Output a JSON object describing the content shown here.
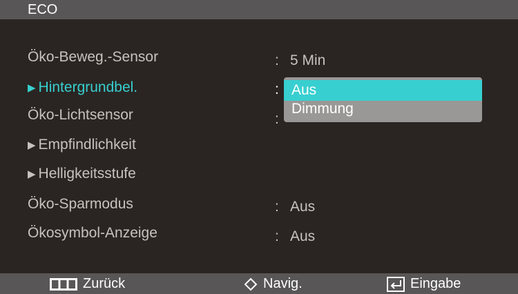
{
  "header": {
    "title": "ECO"
  },
  "menu": {
    "items": [
      {
        "label": "Öko-Beweg.-Sensor",
        "value": "5 Min"
      },
      {
        "label": "Hintergrundbel.",
        "value": ""
      },
      {
        "label": "Öko-Lichtsensor",
        "value": ""
      },
      {
        "label": "Empfindlichkeit"
      },
      {
        "label": "Helligkeitsstufe"
      },
      {
        "label": "Öko-Sparmodus",
        "value": "Aus"
      },
      {
        "label": "Ökosymbol-Anzeige",
        "value": "Aus"
      }
    ],
    "separator": ":"
  },
  "dropdown": {
    "options": [
      "Aus",
      "Dimmung"
    ],
    "selected": "Aus"
  },
  "footer": {
    "back_label": "Zurück",
    "back_icon": "menu-bars-icon",
    "nav_label": "Navig.",
    "nav_icon": "up-down-diamond-icon",
    "enter_label": "Eingabe",
    "enter_icon": "enter-icon"
  },
  "colors": {
    "background": "#2a2522",
    "bar": "#585656",
    "accent": "#38cfd0",
    "text": "#c7c2bd",
    "dropdown": "#9a9897"
  }
}
